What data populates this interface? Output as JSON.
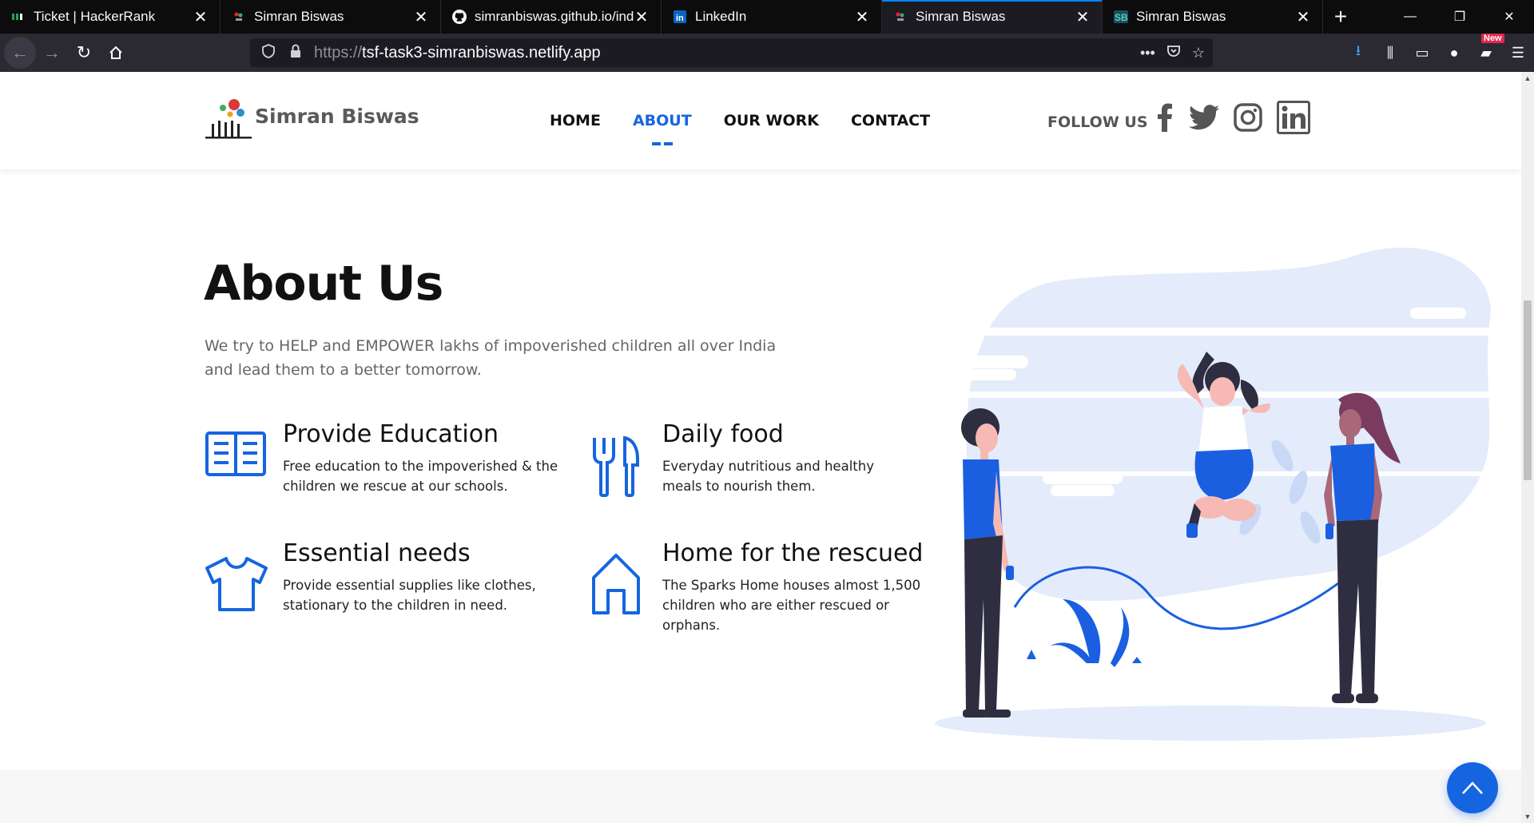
{
  "browser": {
    "tabs": [
      {
        "title": "Ticket | HackerRank",
        "active": false
      },
      {
        "title": "Simran Biswas",
        "active": false
      },
      {
        "title": "simranbiswas.github.io/ind",
        "active": false
      },
      {
        "title": "LinkedIn",
        "active": false
      },
      {
        "title": "Simran Biswas",
        "active": true
      },
      {
        "title": "Simran Biswas",
        "active": false
      }
    ],
    "url_protocol": "https://",
    "url_host": "tsf-task3-simranbiswas.netlify.app",
    "new_badge": "New"
  },
  "header": {
    "brand": "Simran Biswas",
    "menu": [
      {
        "label": "HOME",
        "active": false
      },
      {
        "label": "ABOUT",
        "active": true
      },
      {
        "label": "OUR WORK",
        "active": false
      },
      {
        "label": "CONTACT",
        "active": false
      }
    ],
    "follow_label": "FOLLOW US",
    "social_icons": [
      "facebook-icon",
      "twitter-icon",
      "instagram-icon",
      "linkedin-icon"
    ]
  },
  "about": {
    "title": "About Us",
    "description": "We try to HELP and EMPOWER lakhs of impoverished children all over India and lead them to a better tomorrow.",
    "features": [
      {
        "icon": "book-icon",
        "title": "Provide Education",
        "text": "Free education to the impoverished & the children we rescue at our schools."
      },
      {
        "icon": "fork-knife-icon",
        "title": "Daily food",
        "text": "Everyday nutritious and healthy meals to nourish them."
      },
      {
        "icon": "tshirt-icon",
        "title": "Essential needs",
        "text": "Provide essential supplies like clothes, stationary to the children in need."
      },
      {
        "icon": "house-icon",
        "title": "Home for the rescued",
        "text": "The Sparks Home houses almost 1,500 children who are either rescued or orphans."
      }
    ]
  },
  "colors": {
    "accent": "#1565e0",
    "illustration_blue": "#1a5fe0",
    "illustration_light": "#e4ecfb"
  }
}
